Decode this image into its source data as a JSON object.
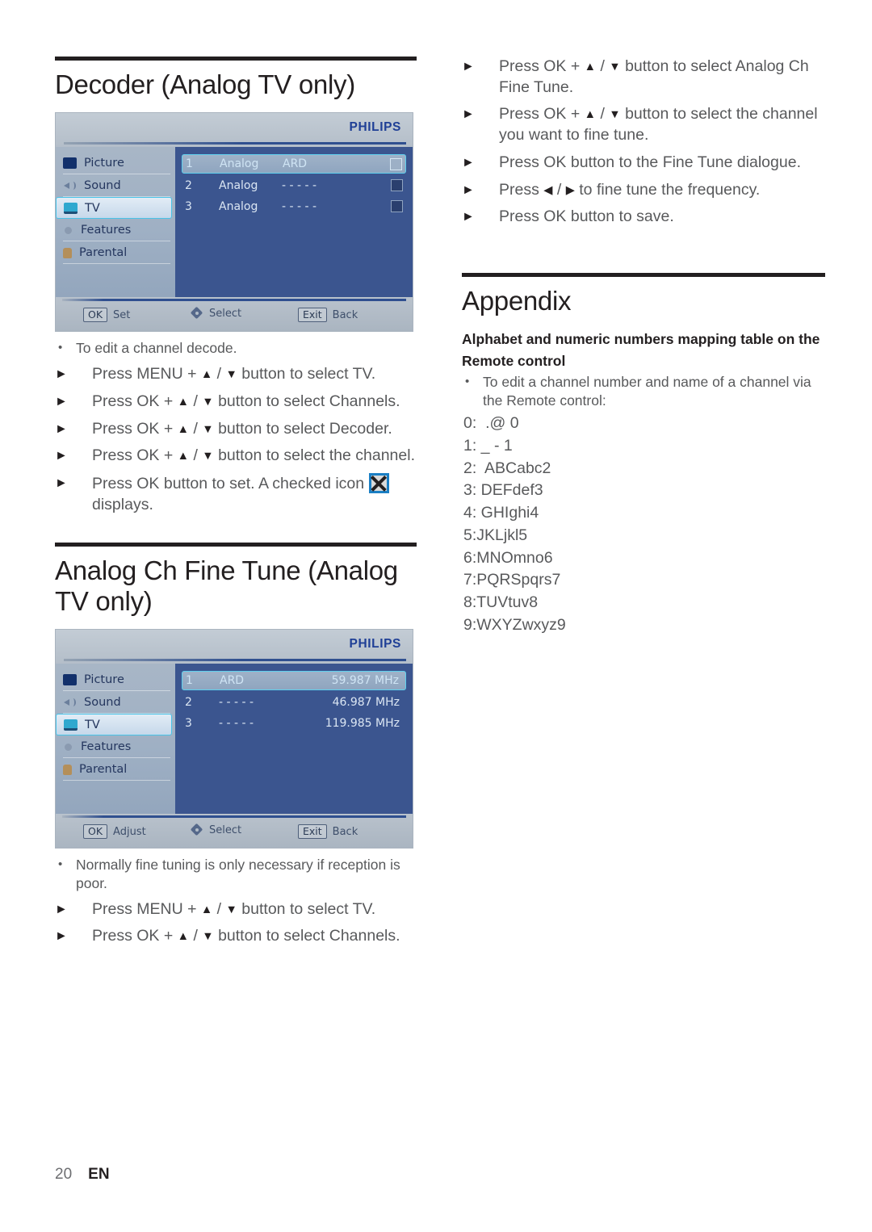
{
  "left": {
    "section1": {
      "title": "Decoder (Analog TV only)",
      "osd": {
        "logo": "PHILIPS",
        "menu": [
          {
            "label": "Picture",
            "icon": "picture-icon",
            "selected": false
          },
          {
            "label": "Sound",
            "icon": "sound-icon",
            "selected": false
          },
          {
            "label": "TV",
            "icon": "tv-icon",
            "selected": true
          },
          {
            "label": "Features",
            "icon": "gear-icon",
            "selected": false
          },
          {
            "label": "Parental",
            "icon": "lock-icon",
            "selected": false
          }
        ],
        "rows": [
          {
            "num": "1",
            "type": "Analog",
            "name": "ARD",
            "selected": true
          },
          {
            "num": "2",
            "type": "Analog",
            "name": "- - - - -",
            "selected": false
          },
          {
            "num": "3",
            "type": "Analog",
            "name": "- - - - -",
            "selected": false
          }
        ],
        "footer": [
          {
            "key": "OK",
            "action": "Set"
          },
          {
            "key": "nav",
            "action": "Select"
          },
          {
            "key": "Exit",
            "action": "Back"
          }
        ]
      },
      "note": "To edit a channel decode.",
      "steps": [
        {
          "pre": "Press MENU + ",
          "up": "▲",
          "sep": " / ",
          "down": "▼",
          "post": " button to select TV."
        },
        {
          "pre": "Press OK + ",
          "up": "▲",
          "sep": " / ",
          "down": "▼",
          "post": " button to select Channels."
        },
        {
          "pre": "Press OK + ",
          "up": "▲",
          "sep": " / ",
          "down": "▼",
          "post": " button to select Decoder."
        },
        {
          "pre": "Press OK + ",
          "up": "▲",
          "sep": " / ",
          "down": "▼",
          "post": " button to select the channel."
        }
      ],
      "final_step": {
        "pre": "Press OK button to set. A checked icon ",
        "post": " displays."
      }
    },
    "section2": {
      "title": "Analog Ch Fine Tune (Analog TV only)",
      "osd": {
        "logo": "PHILIPS",
        "menu": [
          {
            "label": "Picture",
            "icon": "picture-icon",
            "selected": false
          },
          {
            "label": "Sound",
            "icon": "sound-icon",
            "selected": false
          },
          {
            "label": "TV",
            "icon": "tv-icon",
            "selected": true
          },
          {
            "label": "Features",
            "icon": "gear-icon",
            "selected": false
          },
          {
            "label": "Parental",
            "icon": "lock-icon",
            "selected": false
          }
        ],
        "rows": [
          {
            "num": "1",
            "name": "ARD",
            "freq": "59.987 MHz",
            "selected": true
          },
          {
            "num": "2",
            "name": "- - - - -",
            "freq": "46.987 MHz",
            "selected": false
          },
          {
            "num": "3",
            "name": "- - - - -",
            "freq": "119.985 MHz",
            "selected": false
          }
        ],
        "footer": [
          {
            "key": "OK",
            "action": "Adjust"
          },
          {
            "key": "nav",
            "action": "Select"
          },
          {
            "key": "Exit",
            "action": "Back"
          }
        ]
      },
      "note": "Normally fine tuning is only necessary if reception is poor.",
      "steps": [
        {
          "pre": "Press MENU + ",
          "up": "▲",
          "sep": " / ",
          "down": "▼",
          "post": " button to select TV."
        },
        {
          "pre": "Press OK + ",
          "up": "▲",
          "sep": " / ",
          "down": "▼",
          "post": " button to select Channels."
        }
      ]
    }
  },
  "right": {
    "steps_top": [
      {
        "pre": "Press OK + ",
        "up": "▲",
        "sep": " / ",
        "down": "▼",
        "post": " button to select Analog Ch Fine Tune."
      },
      {
        "pre": "Press OK + ",
        "up": "▲",
        "sep": " / ",
        "down": "▼",
        "post": " button to select the channel you want to fine tune."
      },
      {
        "pre": "Press OK button to the Fine Tune dialogue.",
        "up": "",
        "sep": "",
        "down": "",
        "post": ""
      },
      {
        "pre": "Press ",
        "up": "◀",
        "sep": " / ",
        "down": "▶",
        "post": " to fine tune the frequency."
      },
      {
        "pre": "Press OK button to save.",
        "up": "",
        "sep": "",
        "down": "",
        "post": ""
      }
    ],
    "appendix": {
      "title": "Appendix",
      "subtitle": "Alphabet and numeric numbers mapping table on the Remote control",
      "note": "To edit a channel number and name of a channel via the Remote control:",
      "mapping": [
        "0:  .@ 0",
        "1: _ - 1",
        "2:  ABCabc2",
        "3: DEFdef3",
        "4: GHIghi4",
        "5:JKLjkl5",
        "6:MNOmno6",
        "7:PQRSpqrs7",
        "8:TUVtuv8",
        "9:WXYZwxyz9"
      ]
    }
  },
  "footer": {
    "page_number": "20",
    "language": "EN"
  }
}
